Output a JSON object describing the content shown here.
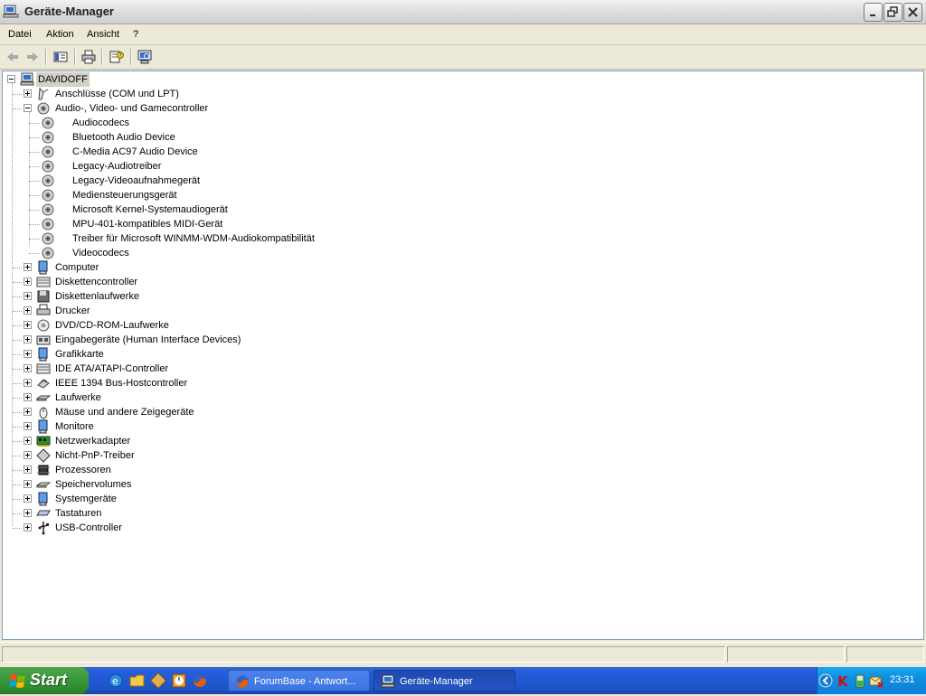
{
  "window": {
    "title": "Geräte-Manager"
  },
  "menu": [
    "Datei",
    "Aktion",
    "Ansicht",
    "?"
  ],
  "toolbar": {
    "buttons": [
      "back-icon",
      "forward-icon",
      "show-hide-tree-icon",
      "print-icon",
      "properties-help-icon",
      "scan-hardware-icon"
    ]
  },
  "tree": {
    "root": "DAVIDOFF",
    "categories": [
      "Anschlüsse (COM und LPT)",
      "Audio-, Video- und Gamecontroller",
      "Computer",
      "Diskettencontroller",
      "Diskettenlaufwerke",
      "Drucker",
      "DVD/CD-ROM-Laufwerke",
      "Eingabegeräte (Human Interface Devices)",
      "Grafikkarte",
      "IDE ATA/ATAPI-Controller",
      "IEEE 1394 Bus-Hostcontroller",
      "Laufwerke",
      "Mäuse und andere Zeigegeräte",
      "Monitore",
      "Netzwerkadapter",
      "Nicht-PnP-Treiber",
      "Prozessoren",
      "Speichervolumes",
      "Systemgeräte",
      "Tastaturen",
      "USB-Controller"
    ],
    "audio_children": [
      "Audiocodecs",
      "Bluetooth Audio Device",
      "C-Media AC97 Audio Device",
      "Legacy-Audiotreiber",
      "Legacy-Videoaufnahmegerät",
      "Mediensteuerungsgerät",
      "Microsoft Kernel-Systemaudiogerät",
      "MPU-401-kompatibles MIDI-Gerät",
      "Treiber für Microsoft WINMM-WDM-Audiokompatibilität",
      "Videocodecs"
    ]
  },
  "taskbar": {
    "start_label": "Start",
    "tasks": [
      {
        "label": "ForumBase - Antwort...",
        "active": false
      },
      {
        "label": "Geräte-Manager",
        "active": true
      }
    ],
    "clock": "23:31"
  }
}
